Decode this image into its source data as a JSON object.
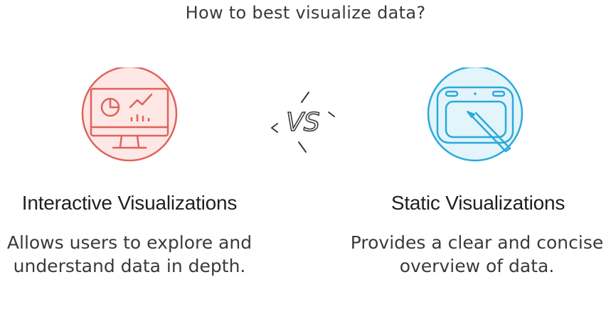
{
  "title": "How to best visualize data?",
  "vs_label": "VS",
  "options": [
    {
      "title": "Interactive Visualizations",
      "description": "Allows users to explore and understand data in depth.",
      "icon": "monitor-chart-icon",
      "accent": "#e0625a",
      "fill": "#fde8e6"
    },
    {
      "title": "Static Visualizations",
      "description": "Provides a clear and concise overview of data.",
      "icon": "drawing-tablet-icon",
      "accent": "#2aa9dc",
      "fill": "#e3f4fb"
    }
  ]
}
